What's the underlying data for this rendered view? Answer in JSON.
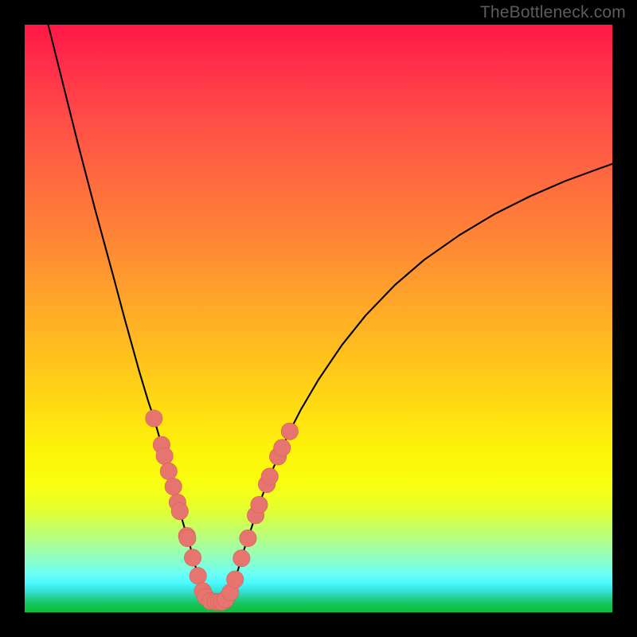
{
  "watermark": "TheBottleneck.com",
  "colors": {
    "frame": "#000000",
    "curve": "#000000",
    "marker_fill": "#e6756f",
    "marker_stroke": "#d8615b"
  },
  "chart_data": {
    "type": "line",
    "title": "",
    "xlabel": "",
    "ylabel": "",
    "xlim": [
      0,
      100
    ],
    "ylim": [
      0,
      100
    ],
    "curve": {
      "comment": "y as a function of x, percentage coordinates (0 at bottom-left). Approximate readings from image.",
      "points": [
        {
          "x": 4.0,
          "y": 100.0
        },
        {
          "x": 6.0,
          "y": 92.0
        },
        {
          "x": 9.0,
          "y": 80.0
        },
        {
          "x": 12.0,
          "y": 68.5
        },
        {
          "x": 15.0,
          "y": 57.5
        },
        {
          "x": 17.0,
          "y": 50.0
        },
        {
          "x": 19.5,
          "y": 41.0
        },
        {
          "x": 21.0,
          "y": 36.0
        },
        {
          "x": 22.0,
          "y": 33.0
        },
        {
          "x": 23.3,
          "y": 28.5
        },
        {
          "x": 23.8,
          "y": 26.6
        },
        {
          "x": 24.0,
          "y": 25.6
        },
        {
          "x": 24.5,
          "y": 24.0
        },
        {
          "x": 24.9,
          "y": 22.4
        },
        {
          "x": 25.3,
          "y": 21.4
        },
        {
          "x": 25.8,
          "y": 19.5
        },
        {
          "x": 26.0,
          "y": 18.7
        },
        {
          "x": 26.4,
          "y": 17.2
        },
        {
          "x": 26.9,
          "y": 15.4
        },
        {
          "x": 27.4,
          "y": 13.7
        },
        {
          "x": 27.6,
          "y": 13.0
        },
        {
          "x": 27.7,
          "y": 12.6
        },
        {
          "x": 28.2,
          "y": 11.1
        },
        {
          "x": 28.6,
          "y": 9.3
        },
        {
          "x": 29.1,
          "y": 7.7
        },
        {
          "x": 29.5,
          "y": 6.2
        },
        {
          "x": 29.7,
          "y": 5.5
        },
        {
          "x": 30.3,
          "y": 3.6
        },
        {
          "x": 30.5,
          "y": 3.2
        },
        {
          "x": 30.8,
          "y": 2.6
        },
        {
          "x": 31.3,
          "y": 2.0
        },
        {
          "x": 31.6,
          "y": 1.9
        },
        {
          "x": 32.0,
          "y": 1.8
        },
        {
          "x": 32.5,
          "y": 1.8
        },
        {
          "x": 33.1,
          "y": 1.8
        },
        {
          "x": 33.6,
          "y": 1.8
        },
        {
          "x": 33.9,
          "y": 2.0
        },
        {
          "x": 34.2,
          "y": 2.2
        },
        {
          "x": 34.6,
          "y": 2.6
        },
        {
          "x": 35.0,
          "y": 3.4
        },
        {
          "x": 35.5,
          "y": 4.6
        },
        {
          "x": 35.8,
          "y": 5.6
        },
        {
          "x": 36.3,
          "y": 7.2
        },
        {
          "x": 36.9,
          "y": 9.2
        },
        {
          "x": 37.4,
          "y": 10.9
        },
        {
          "x": 38.0,
          "y": 12.6
        },
        {
          "x": 38.7,
          "y": 14.7
        },
        {
          "x": 39.3,
          "y": 16.5
        },
        {
          "x": 39.9,
          "y": 18.3
        },
        {
          "x": 40.5,
          "y": 20.0
        },
        {
          "x": 41.2,
          "y": 21.8
        },
        {
          "x": 41.7,
          "y": 23.1
        },
        {
          "x": 42.5,
          "y": 25.0
        },
        {
          "x": 43.1,
          "y": 26.5
        },
        {
          "x": 43.8,
          "y": 28.0
        },
        {
          "x": 45.1,
          "y": 30.8
        },
        {
          "x": 47.0,
          "y": 34.5
        },
        {
          "x": 50.0,
          "y": 39.6
        },
        {
          "x": 54.0,
          "y": 45.5
        },
        {
          "x": 58.0,
          "y": 50.5
        },
        {
          "x": 63.0,
          "y": 55.7
        },
        {
          "x": 68.0,
          "y": 60.0
        },
        {
          "x": 74.0,
          "y": 64.2
        },
        {
          "x": 80.0,
          "y": 67.8
        },
        {
          "x": 86.0,
          "y": 70.8
        },
        {
          "x": 92.0,
          "y": 73.4
        },
        {
          "x": 98.0,
          "y": 75.6
        },
        {
          "x": 100.0,
          "y": 76.3
        }
      ]
    },
    "markers": {
      "comment": "Pink circular markers along the curve near the minimum, percentage coordinates.",
      "radius_pct": 1.45,
      "points": [
        {
          "x": 22.0,
          "y": 33.0
        },
        {
          "x": 23.3,
          "y": 28.5
        },
        {
          "x": 23.8,
          "y": 26.6
        },
        {
          "x": 24.5,
          "y": 24.0
        },
        {
          "x": 25.3,
          "y": 21.4
        },
        {
          "x": 26.0,
          "y": 18.7
        },
        {
          "x": 26.4,
          "y": 17.2
        },
        {
          "x": 27.6,
          "y": 13.0
        },
        {
          "x": 27.7,
          "y": 12.6
        },
        {
          "x": 28.6,
          "y": 9.3
        },
        {
          "x": 29.5,
          "y": 6.2
        },
        {
          "x": 30.3,
          "y": 3.6
        },
        {
          "x": 30.8,
          "y": 2.6
        },
        {
          "x": 31.6,
          "y": 1.9
        },
        {
          "x": 32.5,
          "y": 1.8
        },
        {
          "x": 33.1,
          "y": 1.8
        },
        {
          "x": 33.6,
          "y": 1.8
        },
        {
          "x": 34.2,
          "y": 2.2
        },
        {
          "x": 35.0,
          "y": 3.4
        },
        {
          "x": 35.8,
          "y": 5.6
        },
        {
          "x": 36.9,
          "y": 9.2
        },
        {
          "x": 38.0,
          "y": 12.6
        },
        {
          "x": 39.3,
          "y": 16.5
        },
        {
          "x": 39.9,
          "y": 18.3
        },
        {
          "x": 41.2,
          "y": 21.8
        },
        {
          "x": 41.7,
          "y": 23.1
        },
        {
          "x": 43.1,
          "y": 26.5
        },
        {
          "x": 43.8,
          "y": 28.0
        },
        {
          "x": 45.1,
          "y": 30.8
        }
      ]
    }
  }
}
